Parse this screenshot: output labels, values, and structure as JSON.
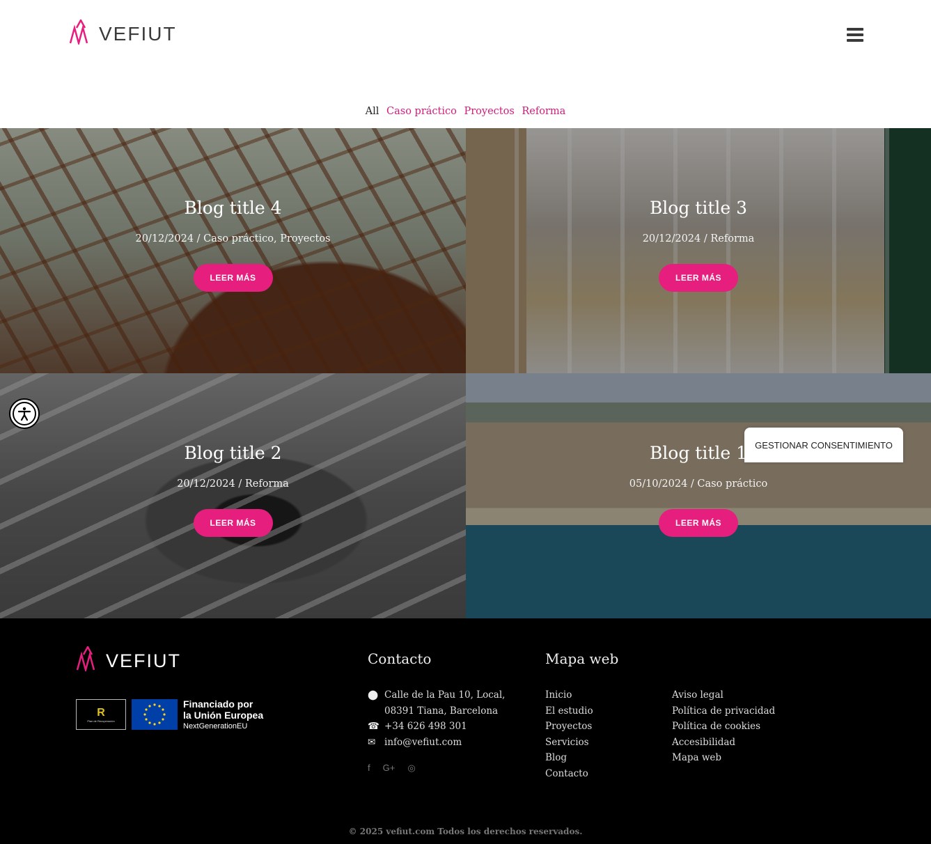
{
  "header": {
    "logo_text": "VEFIUT",
    "menu_icon": "hamburger-icon"
  },
  "filters": {
    "all": "All",
    "categories": [
      "Caso práctico",
      "Proyectos",
      "Reforma"
    ]
  },
  "posts": [
    {
      "title": "Blog title 4",
      "meta": "20/12/2024 / Caso práctico, Proyectos",
      "button": "LEER MÁS"
    },
    {
      "title": "Blog title 3",
      "meta": "20/12/2024 / Reforma",
      "button": "LEER MÁS"
    },
    {
      "title": "Blog title 2",
      "meta": "20/12/2024 / Reforma",
      "button": "LEER MÁS"
    },
    {
      "title": "Blog title 1",
      "meta": "05/10/2024 / Caso práctico",
      "button": "LEER MÁS"
    }
  ],
  "consent": "GESTIONAR CONSENTIMIENTO",
  "footer": {
    "logo_text": "VEFIUT",
    "eu_text_1": "Financiado por",
    "eu_text_2": "la Unión Europea",
    "eu_text_3": "NextGenerationEU",
    "contact_title": "Contacto",
    "address_1": "Calle de la Pau 10, Local,",
    "address_2": "08391 Tiana, Barcelona",
    "phone": "+34 626 498 301",
    "email": "info@vefiut.com",
    "social": [
      "f",
      "G+",
      "◎"
    ],
    "map_title": "Mapa web",
    "map_col1": [
      "Inicio",
      "El estudio",
      "Proyectos",
      "Servicios",
      "Blog",
      "Contacto"
    ],
    "map_col2": [
      "Aviso legal",
      "Política de privacidad",
      "Política de cookies",
      "Accesibilidad",
      "Mapa web"
    ],
    "copyright": "© 2025 vefiut.com Todos los derechos reservados."
  },
  "colors": {
    "accent": "#e61f7f",
    "link": "#d21c7c",
    "footer_bg": "#000000"
  }
}
